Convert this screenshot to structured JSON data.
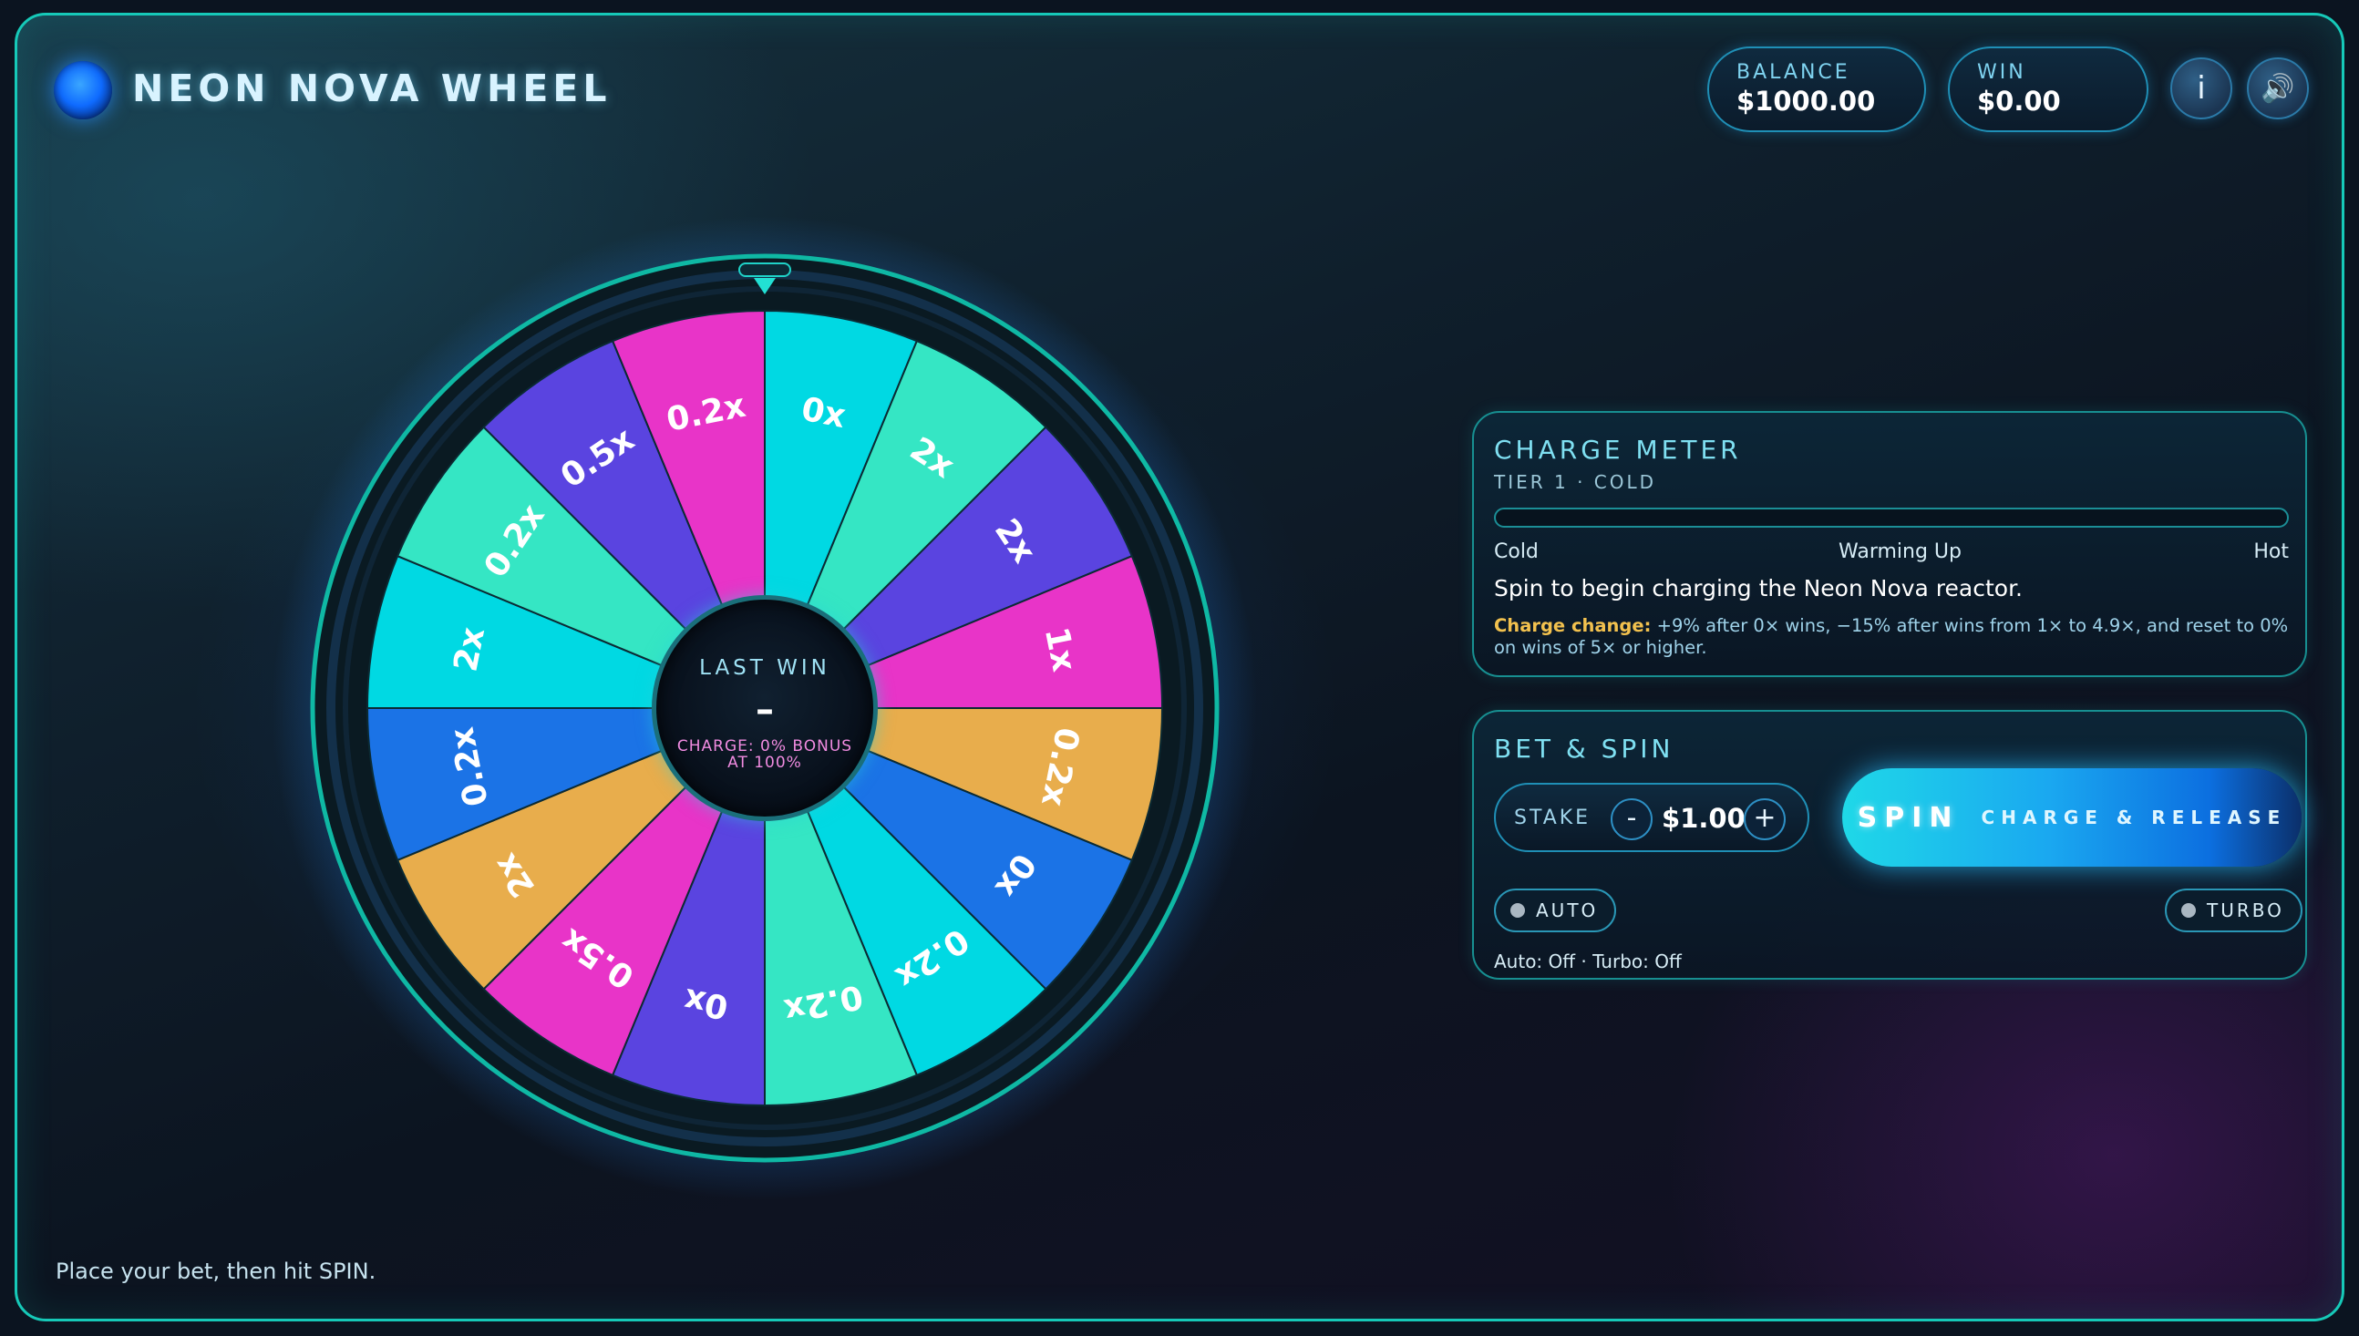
{
  "header": {
    "title": "NEON NOVA WHEEL",
    "balance_label": "BALANCE",
    "balance_value": "$1000.00",
    "win_label": "WIN",
    "win_value": "$0.00",
    "info_icon_glyph": "i",
    "sound_icon_glyph": "🔊"
  },
  "wheel": {
    "segments": [
      {
        "label": "0x",
        "color": "#00d9e3"
      },
      {
        "label": "2x",
        "color": "#35e6c4"
      },
      {
        "label": "2x",
        "color": "#5a44e0"
      },
      {
        "label": "1x",
        "color": "#e834c8"
      },
      {
        "label": "0.2x",
        "color": "#e8ad4c"
      },
      {
        "label": "0x",
        "color": "#1b73e6"
      },
      {
        "label": "0.2x",
        "color": "#00d9e3"
      },
      {
        "label": "0.2x",
        "color": "#35e6c4"
      },
      {
        "label": "0x",
        "color": "#5a44e0"
      },
      {
        "label": "0.5x",
        "color": "#e834c8"
      },
      {
        "label": "2x",
        "color": "#e8ad4c"
      },
      {
        "label": "0.2x",
        "color": "#1b73e6"
      },
      {
        "label": "2x",
        "color": "#00d9e3"
      },
      {
        "label": "0.2x",
        "color": "#35e6c4"
      },
      {
        "label": "0.5x",
        "color": "#5a44e0"
      },
      {
        "label": "0.2x",
        "color": "#e834c8"
      }
    ],
    "hub": {
      "label": "LAST WIN",
      "value": "–",
      "charge_line1": "CHARGE: 0% BONUS",
      "charge_line2": "AT 100%"
    }
  },
  "charge_panel": {
    "title": "CHARGE METER",
    "tier": "TIER 1 · COLD",
    "meter_level": 0,
    "scale_cold": "Cold",
    "scale_warm": "Warming Up",
    "scale_hot": "Hot",
    "message": "Spin to begin charging the Neon Nova reactor.",
    "note_label": "Charge change:",
    "note_text": " +9% after 0× wins, −15% after wins from 1× to 4.9×, and reset to 0% on wins of 5× or higher."
  },
  "bet_panel": {
    "title": "BET & SPIN",
    "stake_label": "STAKE",
    "minus_label": "-",
    "plus_label": "+",
    "stake_value": "$1.00",
    "spin_label": "SPIN",
    "spin_sublabel": "CHARGE & RELEASE",
    "auto_label": "AUTO",
    "turbo_label": "TURBO",
    "mode_status": "Auto: Off · Turbo: Off"
  },
  "footer": {
    "message": "Place your bet, then hit SPIN."
  }
}
